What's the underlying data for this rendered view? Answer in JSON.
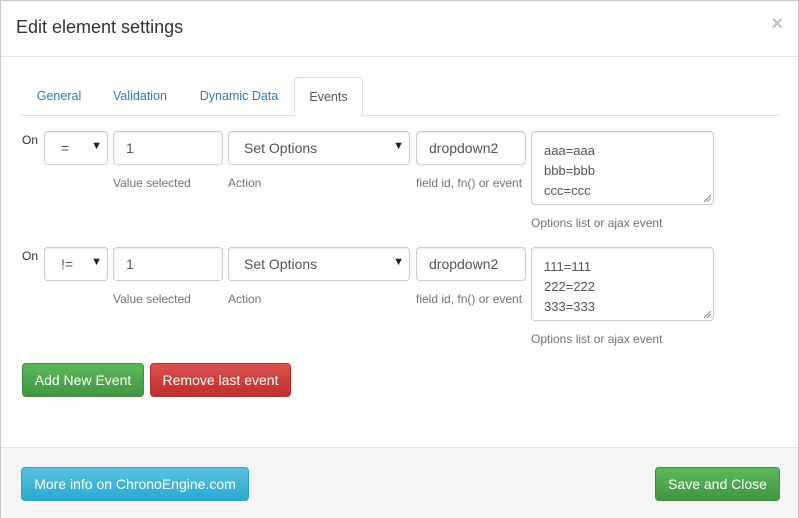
{
  "modal": {
    "title": "Edit element settings",
    "close_glyph": "×"
  },
  "tabs": [
    {
      "label": "General",
      "active": false
    },
    {
      "label": "Validation",
      "active": false
    },
    {
      "label": "Dynamic Data",
      "active": false
    },
    {
      "label": "Events",
      "active": true
    }
  ],
  "events": [
    {
      "on_label": "On",
      "operator": "=",
      "value": "1",
      "value_help": "Value selected",
      "action": "Set Options",
      "action_help": "Action",
      "target": "dropdown2",
      "target_help": "field id, fn() or event",
      "options": [
        "aaa=aaa",
        "bbb=bbb",
        "ccc=ccc"
      ],
      "options_help": "Options list or ajax event"
    },
    {
      "on_label": "On",
      "operator": "!=",
      "value": "1",
      "value_help": "Value selected",
      "action": "Set Options",
      "action_help": "Action",
      "target": "dropdown2",
      "target_help": "field id, fn() or event",
      "options": [
        "111=111",
        "222=222",
        "333=333"
      ],
      "options_help": "Options list or ajax event"
    }
  ],
  "buttons": {
    "add_event": "Add New Event",
    "remove_event": "Remove last event",
    "more_info": "More info on ChronoEngine.com",
    "save_close": "Save and Close"
  },
  "icons": {
    "caret": "▼",
    "close": "close-icon"
  }
}
